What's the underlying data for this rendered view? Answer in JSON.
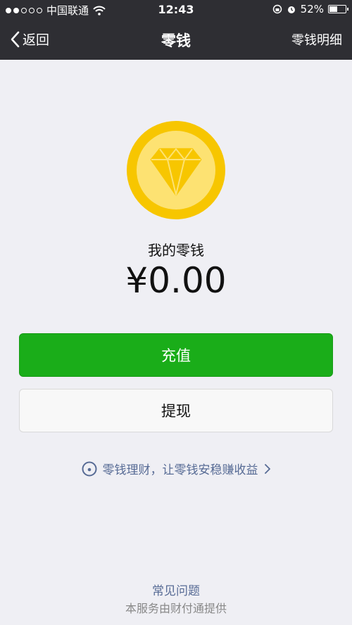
{
  "status_bar": {
    "carrier": "中国联通",
    "time": "12:43",
    "battery": "52%",
    "battery_level": 0.52,
    "signal_strength": 2
  },
  "nav": {
    "back_label": "返回",
    "title": "零钱",
    "right_label": "零钱明细"
  },
  "wallet": {
    "label": "我的零钱",
    "amount": "¥0.00"
  },
  "buttons": {
    "recharge": "充值",
    "withdraw": "提现"
  },
  "promo": {
    "text": "零钱理财，让零钱安稳赚收益"
  },
  "footer": {
    "faq": "常见问题",
    "provider": "本服务由财付通提供"
  },
  "colors": {
    "nav_bg": "#2e2e33",
    "primary_green": "#1aad19",
    "link_blue": "#576b95",
    "coin_gold": "#f7c600"
  }
}
